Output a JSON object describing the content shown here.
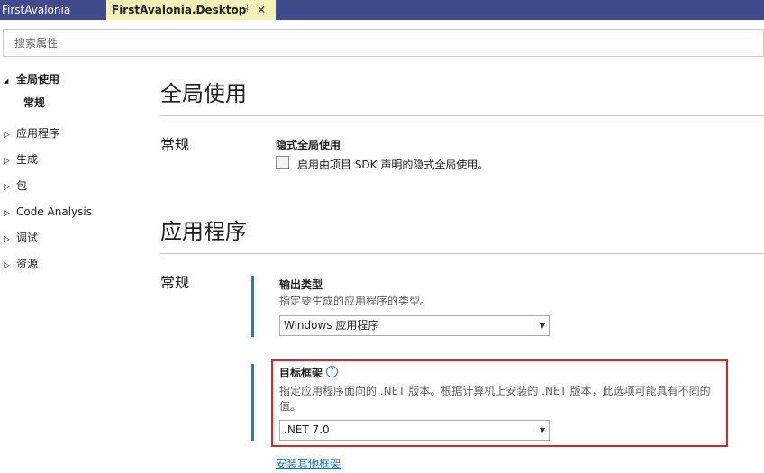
{
  "tabs": {
    "inactive_label": "FirstAvalonia",
    "active_label": "FirstAvalonia.Desktop",
    "pin_glyph": "⊣",
    "close_glyph": "✕"
  },
  "search": {
    "placeholder": "搜索属性"
  },
  "sidebar": {
    "items": [
      {
        "label": "全局使用",
        "expanded": true
      },
      {
        "label": "常规"
      },
      {
        "label": "应用程序"
      },
      {
        "label": "生成"
      },
      {
        "label": "包"
      },
      {
        "label": "Code Analysis"
      },
      {
        "label": "调试"
      },
      {
        "label": "资源"
      }
    ],
    "collapsed_glyph": "▷",
    "expanded_glyph": "◢"
  },
  "sections": {
    "global": {
      "title": "全局使用",
      "group": "常规",
      "setting_label": "隐式全局使用",
      "checkbox_label": "启用由项目 SDK 声明的隐式全局使用。",
      "checked": false
    },
    "application": {
      "title": "应用程序",
      "group": "常规",
      "output_type": {
        "label": "输出类型",
        "description": "指定要生成的应用程序的类型。",
        "value": "Windows 应用程序"
      },
      "target_framework": {
        "label": "目标框架",
        "help_glyph": "?",
        "description_line1": "指定应用程序面向的 .NET 版本。根据计算机上安装的 .NET 版本，此选项可能具有不同的",
        "description_line2": "值。",
        "value": ".NET 7.0",
        "link": "安装其他框架"
      }
    }
  },
  "colors": {
    "tabstrip": "#414b8c",
    "active_tab": "#f5f0b8",
    "accent_bar": "#1f7ad1",
    "highlight_box": "#d6272b",
    "link": "#1f6fc5"
  }
}
